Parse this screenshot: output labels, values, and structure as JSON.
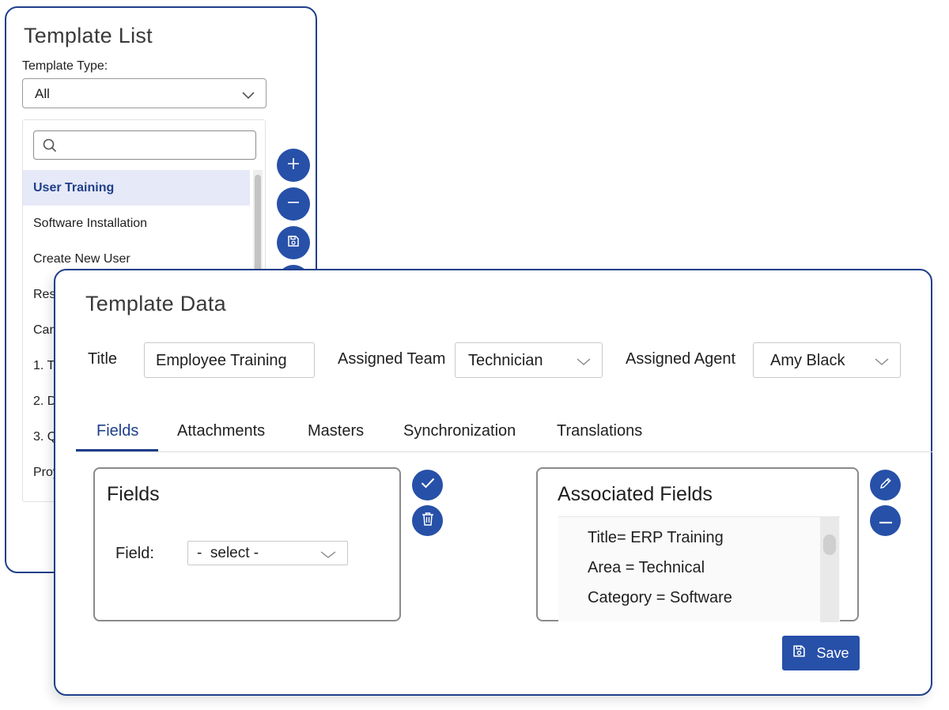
{
  "template_list": {
    "title": "Template List",
    "type_label": "Template Type:",
    "type_value": "All",
    "search_placeholder": "",
    "items": [
      {
        "label": "User Training",
        "selected": true
      },
      {
        "label": "Software Installation",
        "selected": false
      },
      {
        "label": "Create New User",
        "selected": false
      },
      {
        "label": "Res",
        "selected": false
      },
      {
        "label": "Can",
        "selected": false
      },
      {
        "label": "1. T",
        "selected": false
      },
      {
        "label": "2. D",
        "selected": false
      },
      {
        "label": "3. Q",
        "selected": false
      },
      {
        "label": "Proy",
        "selected": false
      }
    ],
    "side_buttons": [
      "plus-icon",
      "minus-icon",
      "floppy-disk-icon"
    ]
  },
  "template_data": {
    "title": "Template Data",
    "title_label": "Title",
    "title_value": "Employee Training",
    "team_label": "Assigned Team",
    "team_value": "Technician",
    "agent_label": "Assigned Agent",
    "agent_value": "Amy Black",
    "tabs": [
      {
        "label": "Fields",
        "active": true
      },
      {
        "label": "Attachments",
        "active": false
      },
      {
        "label": "Masters",
        "active": false
      },
      {
        "label": "Synchronization",
        "active": false
      },
      {
        "label": "Translations",
        "active": false
      }
    ],
    "fields_box": {
      "title": "Fields",
      "field_label": "Field:",
      "field_value": "-  select -"
    },
    "associated_box": {
      "title": "Associated Fields",
      "items": [
        "Title= ERP Training",
        "Area = Technical",
        "Category = Software"
      ]
    },
    "save_label": "Save"
  },
  "colors": {
    "accent": "#2750a8",
    "panel_border": "#1f3f8a",
    "selected_row": "#e6e9f7"
  }
}
